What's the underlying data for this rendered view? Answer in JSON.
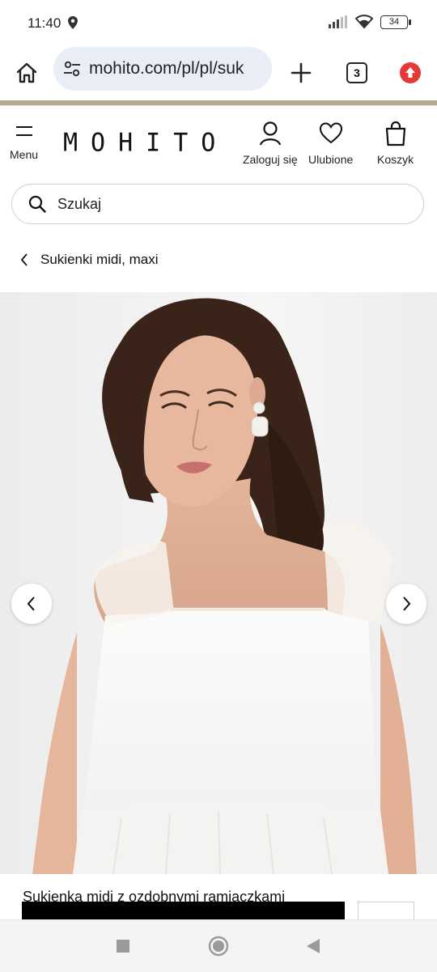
{
  "status": {
    "time": "11:40",
    "battery": "34",
    "icons": [
      "location-icon",
      "signal-icon",
      "wifi-icon",
      "battery-icon"
    ]
  },
  "browser": {
    "url": "mohito.com/pl/pl/suk",
    "tab_count": "3",
    "icons": [
      "home-icon",
      "site-settings-icon",
      "new-tab-icon",
      "tabs-icon",
      "update-icon"
    ]
  },
  "header": {
    "menu_label": "Menu",
    "logo": "MOHITO",
    "login_label": "Zaloguj się",
    "favorites_label": "Ulubione",
    "cart_label": "Koszyk"
  },
  "search": {
    "placeholder": "Szukaj"
  },
  "breadcrumb": {
    "label": "Sukienki midi, maxi"
  },
  "product": {
    "title": "Sukienka midi z ozdobnymi ramiączkami"
  },
  "colors": {
    "accent_bar": "#b5a98d",
    "url_bg": "#e9eef6",
    "update_icon": "#e53935"
  }
}
